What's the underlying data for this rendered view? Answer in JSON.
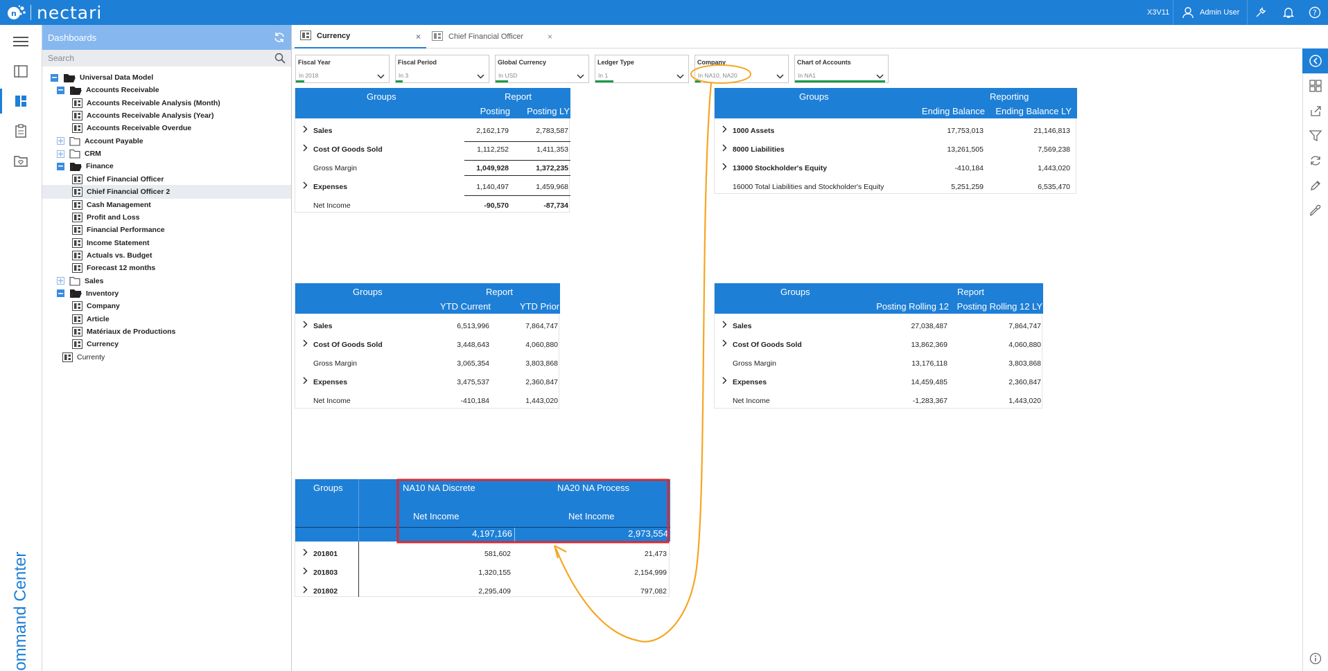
{
  "app": {
    "name": "nectari",
    "env": "X3V11",
    "user": "Admin User",
    "side_label": "Command Center"
  },
  "panel": {
    "title": "Dashboards",
    "search_placeholder": "Search",
    "tree": [
      {
        "label": "Universal Data Model",
        "level": 0,
        "type": "folder",
        "state": "open"
      },
      {
        "label": "Accounts Receivable",
        "level": 1,
        "type": "folder",
        "state": "open"
      },
      {
        "label": "Accounts Receivable Analysis (Month)",
        "level": 2,
        "type": "dash"
      },
      {
        "label": "Accounts Receivable Analysis (Year)",
        "level": 2,
        "type": "dash"
      },
      {
        "label": "Accounts Receivable Overdue",
        "level": 2,
        "type": "dash"
      },
      {
        "label": "Account Payable",
        "level": 1,
        "type": "folder",
        "state": "closed"
      },
      {
        "label": "CRM",
        "level": 1,
        "type": "folder",
        "state": "closed"
      },
      {
        "label": "Finance",
        "level": 1,
        "type": "folder",
        "state": "open"
      },
      {
        "label": "Chief Financial Officer",
        "level": 2,
        "type": "dash"
      },
      {
        "label": "Chief Financial Officer 2",
        "level": 2,
        "type": "dash",
        "selected": true
      },
      {
        "label": "Cash Management",
        "level": 2,
        "type": "dash"
      },
      {
        "label": "Profit and Loss",
        "level": 2,
        "type": "dash"
      },
      {
        "label": "Financial Performance",
        "level": 2,
        "type": "dash"
      },
      {
        "label": "Income Statement",
        "level": 2,
        "type": "dash"
      },
      {
        "label": "Actuals vs. Budget",
        "level": 2,
        "type": "dash"
      },
      {
        "label": "Forecast 12 months",
        "level": 2,
        "type": "dash"
      },
      {
        "label": "Sales",
        "level": 1,
        "type": "folder",
        "state": "closed"
      },
      {
        "label": "Inventory",
        "level": 1,
        "type": "folder",
        "state": "open"
      },
      {
        "label": "Company",
        "level": 2,
        "type": "dash"
      },
      {
        "label": "Article",
        "level": 2,
        "type": "dash"
      },
      {
        "label": "Matériaux de Productions",
        "level": 2,
        "type": "dash"
      },
      {
        "label": "Currency",
        "level": 2,
        "type": "dash"
      },
      {
        "label": "Currenty",
        "level": 1,
        "type": "dash",
        "plain": true
      }
    ]
  },
  "tabs": [
    {
      "label": "Currency",
      "active": true
    },
    {
      "label": "Chief Financial Officer",
      "active": false
    }
  ],
  "filters": [
    {
      "label": "Fiscal Year",
      "value": "In 2018"
    },
    {
      "label": "Fiscal Period",
      "value": "In 3"
    },
    {
      "label": "Global Currency",
      "value": "In USD"
    },
    {
      "label": "Ledger Type",
      "value": "In 1"
    },
    {
      "label": "Company",
      "value": "In NA10, NA20"
    },
    {
      "label": "Chart of Accounts",
      "value": "In NA1"
    }
  ],
  "tables": {
    "t1": {
      "col0": "Groups",
      "group": "Report",
      "cols": [
        "Posting",
        "Posting LY"
      ],
      "rows": [
        {
          "label": "Sales",
          "exp": true,
          "v": [
            "2,162,179",
            "2,783,587"
          ]
        },
        {
          "label": "Cost Of Goods Sold",
          "exp": true,
          "v": [
            "1,112,252",
            "1,411,353"
          ]
        },
        {
          "label": "Gross Margin",
          "exp": false,
          "v": [
            "1,049,928",
            "1,372,235"
          ],
          "bold": true
        },
        {
          "label": "Expenses",
          "exp": true,
          "v": [
            "1,140,497",
            "1,459,968"
          ]
        },
        {
          "label": "Net Income",
          "exp": false,
          "v": [
            "-90,570",
            "-87,734"
          ],
          "bold": true
        }
      ]
    },
    "t2": {
      "col0": "Groups",
      "group": "Reporting",
      "cols": [
        "Ending Balance",
        "Ending Balance LY"
      ],
      "rows": [
        {
          "label": "1000 Assets",
          "exp": true,
          "v": [
            "17,753,013",
            "21,146,813"
          ]
        },
        {
          "label": "8000 Liabilities",
          "exp": true,
          "v": [
            "13,261,505",
            "7,569,238"
          ]
        },
        {
          "label": "13000 Stockholder's Equity",
          "exp": true,
          "v": [
            "-410,184",
            "1,443,020"
          ]
        },
        {
          "label": "16000 Total Liabilities and Stockholder's Equity",
          "exp": false,
          "v": [
            "5,251,259",
            "6,535,470"
          ]
        }
      ]
    },
    "t3": {
      "col0": "Groups",
      "group": "Report",
      "cols": [
        "YTD Current",
        "YTD Prior"
      ],
      "rows": [
        {
          "label": "Sales",
          "exp": true,
          "v": [
            "6,513,996",
            "7,864,747"
          ]
        },
        {
          "label": "Cost Of Goods Sold",
          "exp": true,
          "v": [
            "3,448,643",
            "4,060,880"
          ]
        },
        {
          "label": "Gross Margin",
          "exp": false,
          "v": [
            "3,065,354",
            "3,803,868"
          ]
        },
        {
          "label": "Expenses",
          "exp": true,
          "v": [
            "3,475,537",
            "2,360,847"
          ]
        },
        {
          "label": "Net Income",
          "exp": false,
          "v": [
            "-410,184",
            "1,443,020"
          ]
        }
      ]
    },
    "t4": {
      "col0": "Groups",
      "group": "Report",
      "cols": [
        "Posting Rolling 12",
        "Posting Rolling 12 LY"
      ],
      "rows": [
        {
          "label": "Sales",
          "exp": true,
          "v": [
            "27,038,487",
            "7,864,747"
          ]
        },
        {
          "label": "Cost Of Goods Sold",
          "exp": true,
          "v": [
            "13,862,369",
            "4,060,880"
          ]
        },
        {
          "label": "Gross Margin",
          "exp": false,
          "v": [
            "13,176,118",
            "3,803,868"
          ]
        },
        {
          "label": "Expenses",
          "exp": true,
          "v": [
            "14,459,485",
            "2,360,847"
          ]
        },
        {
          "label": "Net Income",
          "exp": false,
          "v": [
            "-1,283,367",
            "1,443,020"
          ]
        }
      ]
    },
    "t5": {
      "col0": "Groups",
      "companies": [
        "NA10 NA Discrete",
        "NA20 NA Process"
      ],
      "measure": "Net Income",
      "totals": [
        "4,197,166",
        "2,973,554"
      ],
      "rows": [
        {
          "label": "201801",
          "v": [
            "581,602",
            "21,473"
          ]
        },
        {
          "label": "201803",
          "v": [
            "1,320,155",
            "2,154,999"
          ]
        },
        {
          "label": "201802",
          "v": [
            "2,295,409",
            "797,082"
          ]
        }
      ]
    }
  },
  "colors": {
    "primary": "#1e7fd6",
    "panel_head": "#86b8ef",
    "annotation_orange": "#f5a623",
    "annotation_red": "#e0282e",
    "filter_indicator": "#1a9a45"
  }
}
